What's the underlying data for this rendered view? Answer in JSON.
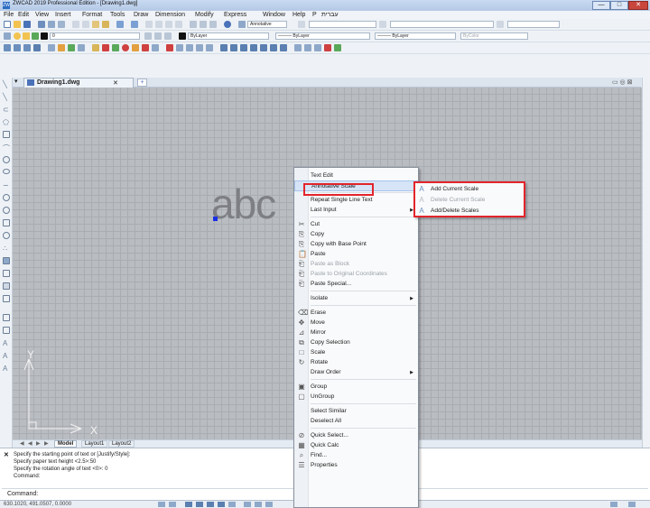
{
  "window": {
    "title": "ZWCAD 2019 Professional Edition - [Drawing1.dwg]",
    "app_icon": "ZW",
    "min": "—",
    "max": "□",
    "close": "✕"
  },
  "menu": [
    "File",
    "Edit",
    "View",
    "Insert",
    "Format",
    "Tools",
    "Draw",
    "Dimension",
    "Modify",
    "Express",
    "Window",
    "Help",
    "P",
    "עברית"
  ],
  "toolbar_props": {
    "layer": "0",
    "color": "ByLayer",
    "linetype": "——— ByLayer",
    "lineweight": "——— ByLayer",
    "plotstyle": "ByColor",
    "annotative": "Annotative"
  },
  "drawing_tab": {
    "name": "Drawing1.dwg",
    "close": "✕",
    "new": "+"
  },
  "canvas": {
    "text": "abc",
    "x_axis": "X",
    "y_axis": "Y"
  },
  "layout_tabs": [
    "Model",
    "Layout1",
    "Layout2"
  ],
  "nav_buttons": [
    "◀",
    "◀",
    "▶",
    "▶"
  ],
  "command": {
    "history": [
      "Specify the starting point of text or [Justify/Style]:",
      "Specify paper text height <2.5>:50",
      "Specify the rotation angle of text <0>: 0",
      "Command:"
    ],
    "prompt": "Command:",
    "close": "✕"
  },
  "status": {
    "coords": "630.1020, 491.0507, 0.0000"
  },
  "context_menu": {
    "items": [
      {
        "label": "Text Edit",
        "icon": "",
        "disabled": false
      },
      {
        "label": "Annotative Scale",
        "icon": "",
        "disabled": false,
        "submenu": true,
        "highlight": true
      },
      {
        "sep": true
      },
      {
        "label": "Repeat Single Line Text",
        "icon": "",
        "disabled": false
      },
      {
        "label": "Last Input",
        "icon": "",
        "disabled": false,
        "submenu": true
      },
      {
        "sep": true
      },
      {
        "label": "Cut",
        "icon": "cut-icon",
        "disabled": false
      },
      {
        "label": "Copy",
        "icon": "copy-icon",
        "disabled": false
      },
      {
        "label": "Copy with Base Point",
        "icon": "copy-base-icon",
        "disabled": false
      },
      {
        "label": "Paste",
        "icon": "paste-icon",
        "disabled": false
      },
      {
        "label": "Paste as Block",
        "icon": "paste-block-icon",
        "disabled": true
      },
      {
        "label": "Paste to Original Coordinates",
        "icon": "paste-coords-icon",
        "disabled": true
      },
      {
        "label": "Paste Special...",
        "icon": "paste-special-icon",
        "disabled": false
      },
      {
        "sep": true
      },
      {
        "label": "Isolate",
        "icon": "",
        "disabled": false,
        "submenu": true
      },
      {
        "sep": true
      },
      {
        "label": "Erase",
        "icon": "erase-icon",
        "disabled": false
      },
      {
        "label": "Move",
        "icon": "move-icon",
        "disabled": false
      },
      {
        "label": "Mirror",
        "icon": "mirror-icon",
        "disabled": false
      },
      {
        "label": "Copy Selection",
        "icon": "copy-selection-icon",
        "disabled": false
      },
      {
        "label": "Scale",
        "icon": "scale-icon",
        "disabled": false
      },
      {
        "label": "Rotate",
        "icon": "rotate-icon",
        "disabled": false
      },
      {
        "label": "Draw Order",
        "icon": "",
        "disabled": false,
        "submenu": true
      },
      {
        "sep": true
      },
      {
        "label": "Group",
        "icon": "group-icon",
        "disabled": false
      },
      {
        "label": "UnGroup",
        "icon": "ungroup-icon",
        "disabled": false
      },
      {
        "sep": true
      },
      {
        "label": "Select Similar",
        "icon": "",
        "disabled": false
      },
      {
        "label": "Deselect All",
        "icon": "",
        "disabled": false
      },
      {
        "sep": true
      },
      {
        "label": "Quick Select...",
        "icon": "quick-select-icon",
        "disabled": false
      },
      {
        "label": "Quick Calc",
        "icon": "quick-calc-icon",
        "disabled": false
      },
      {
        "label": "Find...",
        "icon": "find-icon",
        "disabled": false
      },
      {
        "label": "Properties",
        "icon": "properties-icon",
        "disabled": false
      }
    ]
  },
  "submenu": {
    "items": [
      {
        "label": "Add Current Scale",
        "disabled": false
      },
      {
        "label": "Delete Current Scale",
        "disabled": true
      },
      {
        "label": "Add/Delete Scales",
        "disabled": false
      }
    ]
  },
  "colors": {
    "highlight_box": "#e3242b",
    "canvas_bg": "#b9bcc1",
    "cursor": "#1b2ee8"
  }
}
